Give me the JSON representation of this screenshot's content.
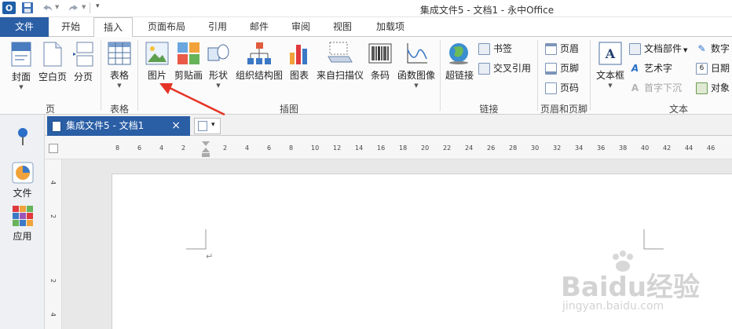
{
  "window": {
    "title": "集成文件5 - 文档1 - 永中Office",
    "app_logo": "O"
  },
  "tabs": [
    {
      "label": "文件"
    },
    {
      "label": "开始"
    },
    {
      "label": "插入"
    },
    {
      "label": "页面布局"
    },
    {
      "label": "引用"
    },
    {
      "label": "邮件"
    },
    {
      "label": "审阅"
    },
    {
      "label": "视图"
    },
    {
      "label": "加载项"
    }
  ],
  "ribbon": {
    "page_group": {
      "label": "页",
      "buttons": [
        {
          "label": "封面"
        },
        {
          "label": "空白页"
        },
        {
          "label": "分页"
        }
      ]
    },
    "table_group": {
      "label": "表格",
      "buttons": [
        {
          "label": "表格"
        }
      ]
    },
    "illus_group": {
      "label": "插图",
      "buttons": [
        {
          "label": "图片"
        },
        {
          "label": "剪贴画"
        },
        {
          "label": "形状"
        },
        {
          "label": "组织结构图"
        },
        {
          "label": "图表"
        },
        {
          "label": "来自扫描仪"
        },
        {
          "label": "条码"
        },
        {
          "label": "函数图像"
        }
      ]
    },
    "link_group": {
      "label": "链接",
      "hyperlink": "超链接",
      "bookmark": "书签",
      "crossref": "交叉引用"
    },
    "hf_group": {
      "label": "页眉和页脚",
      "header": "页眉",
      "footer": "页脚",
      "pagenum": "页码"
    },
    "text_group": {
      "label": "文本",
      "textbox": "文本框",
      "docparts": "文档部件",
      "wordart": "艺术字",
      "dropcap": "首字下沉",
      "digital": "数字",
      "date": "日期",
      "object": "对象"
    }
  },
  "sidebar": {
    "pin": "pin-icon",
    "items": [
      {
        "label": "文件"
      },
      {
        "label": "应用"
      }
    ]
  },
  "doc_tab": {
    "label": "集成文件5 - 文档1",
    "close": "×",
    "new_label": "▾"
  },
  "ruler": {
    "ticks": [
      "8",
      "6",
      "4",
      "2",
      "2",
      "4",
      "6",
      "8",
      "10",
      "12",
      "14",
      "16",
      "18",
      "20",
      "22",
      "24",
      "26",
      "28",
      "30",
      "32",
      "34",
      "36",
      "38",
      "40",
      "42",
      "44",
      "46"
    ]
  },
  "vruler": {
    "ticks": [
      "4",
      "2",
      "2",
      "4"
    ]
  },
  "document": {
    "paragraph_mark": "↵"
  },
  "watermark": {
    "brand": "Baidu经验",
    "url": "jingyan.baidu.com"
  }
}
